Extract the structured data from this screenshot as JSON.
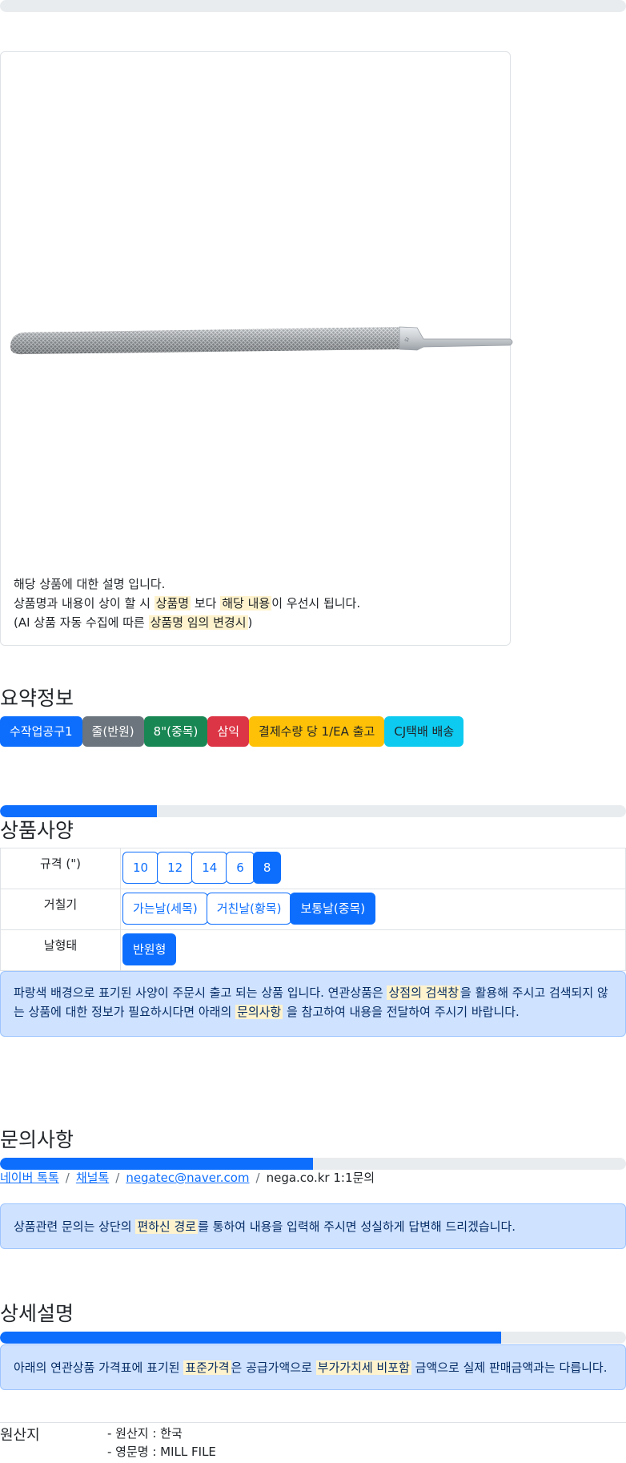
{
  "product": {
    "image_icon": "file-tool-icon",
    "description": {
      "line1": "해당 상품에 대한 설명 입니다.",
      "line2_pre": "상품명과 내용이 상이 할 시",
      "line2_mark1": "상품명",
      "line2_mid": "보다",
      "line2_mark2": "해당 내용",
      "line2_post": "이 우선시 됩니다.",
      "line3_pre": "(AI 상품 자동 수집에 따른",
      "line3_mark": "상품명 임의 변경시",
      "line3_post": ")"
    }
  },
  "summary": {
    "title": "요약정보",
    "badges": [
      {
        "label": "수작업공구1",
        "color": "#0d6efd",
        "text_color": "#ffffff"
      },
      {
        "label": "줄(반원)",
        "color": "#6c757d",
        "text_color": "#ffffff"
      },
      {
        "label": "8\"(중목)",
        "color": "#198754",
        "text_color": "#ffffff"
      },
      {
        "label": "삼익",
        "color": "#dc3545",
        "text_color": "#ffffff"
      },
      {
        "label": "결제수량 당 1/EA 출고",
        "color": "#ffc107",
        "text_color": "#212529"
      },
      {
        "label": "CJ택배 배송",
        "color": "#0dcaf0",
        "text_color": "#212529"
      }
    ]
  },
  "specs": {
    "title": "상품사양",
    "progress": 0.25,
    "rows": [
      {
        "label": "규격 (\")",
        "options": [
          {
            "label": "10",
            "selected": false
          },
          {
            "label": "12",
            "selected": false
          },
          {
            "label": "14",
            "selected": false
          },
          {
            "label": "6",
            "selected": false
          },
          {
            "label": "8",
            "selected": true
          }
        ]
      },
      {
        "label": "거칠기",
        "options": [
          {
            "label": "가는날(세목)",
            "selected": false
          },
          {
            "label": "거친날(황목)",
            "selected": false
          },
          {
            "label": "보통날(중목)",
            "selected": true
          }
        ]
      },
      {
        "label": "날형태",
        "options": [
          {
            "label": "반원형",
            "selected": true
          }
        ]
      }
    ],
    "notice": {
      "pre": "파랑색 배경으로 표기된 사양이 주문시 출고 되는 상품 입니다. 연관상품은",
      "mark1": "상점의 검색창",
      "mid": "을 활용해 주시고 검색되지 않는 상품에 대한 정보가 필요하시다면 아래의",
      "mark2": "문의사항",
      "post": "을 참고하여 내용을 전달하여 주시기 바랍니다."
    }
  },
  "inquiry": {
    "title": "문의사항",
    "progress": 0.5,
    "links": [
      "네이버 톡톡",
      "채널톡",
      "negatec@naver.com"
    ],
    "plain": "nega.co.kr 1:1문의",
    "notice": {
      "pre": "상품관련 문의는 상단의",
      "mark": "편하신 경로",
      "post": "를 통하여 내용을 입력해 주시면 성실하게 답변해 드리겠습니다."
    }
  },
  "detail": {
    "title": "상세설명",
    "progress": 0.8,
    "notice": {
      "pre": "아래의 연관상품 가격표에 표기된",
      "mark1": "표준가격",
      "mid": "은 공급가액으로",
      "mark2": "부가가치세 비포함",
      "post": "금액으로 실제 판매금액과는 다릅니다."
    },
    "origin_label": "원산지",
    "origin_lines": [
      "- 원산지 : 한국",
      "- 영문명 : MILL FILE"
    ]
  }
}
